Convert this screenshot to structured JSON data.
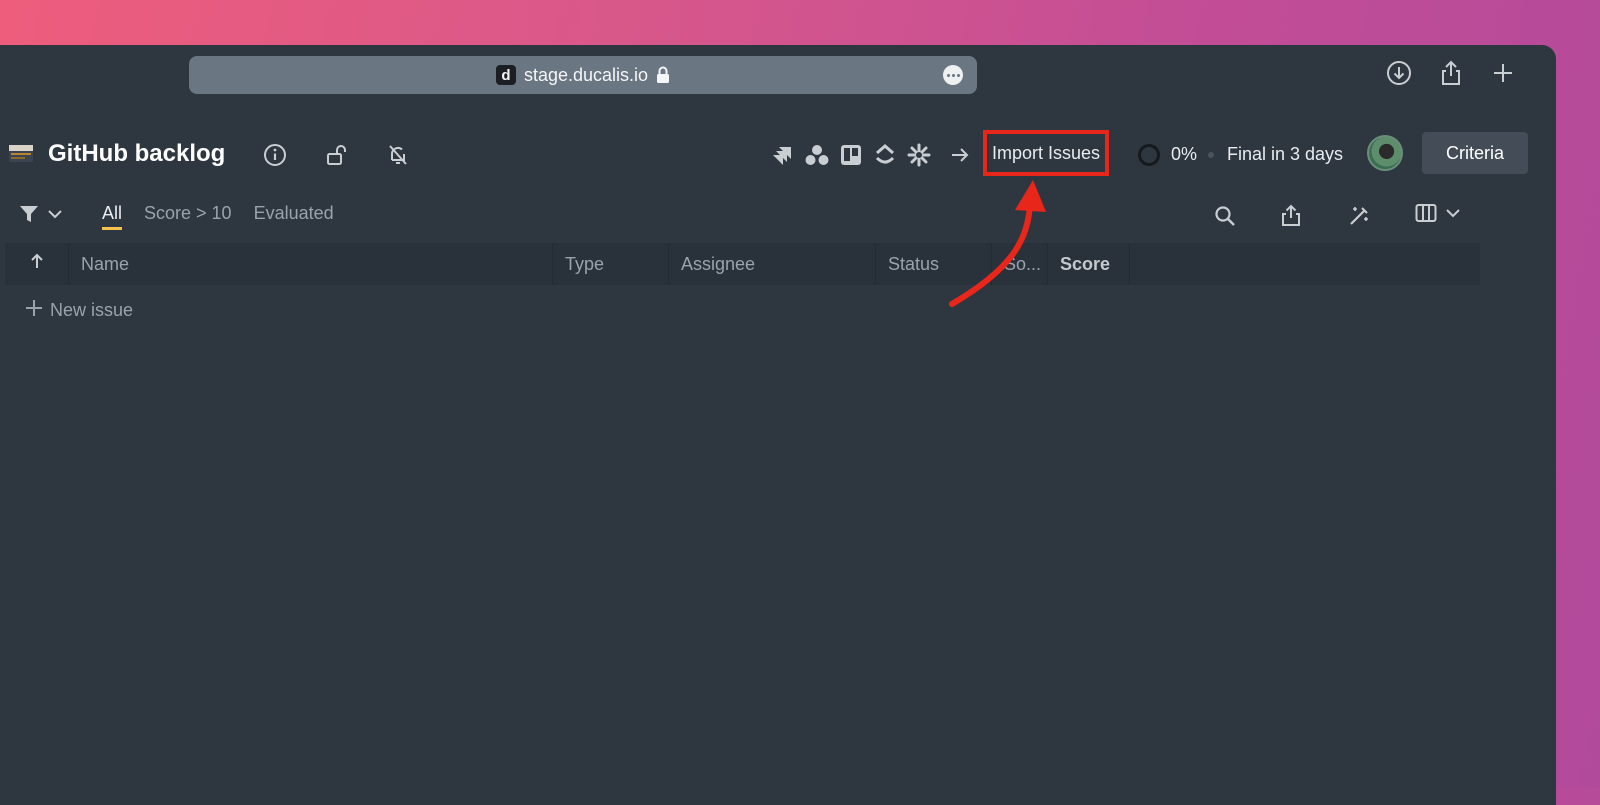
{
  "browser": {
    "favicon_letter": "d",
    "url": "stage.ducalis.io",
    "icons": [
      "lock-icon",
      "more-icon",
      "download-icon",
      "share-icon",
      "new-tab-icon"
    ]
  },
  "header": {
    "title": "GitHub backlog",
    "icons": [
      "info-icon",
      "unlock-icon",
      "notifications-off-icon"
    ],
    "integrations": [
      "jira-icon",
      "asana-icon",
      "trello-icon",
      "clickup-icon",
      "zapier-icon"
    ],
    "import_label": "Import Issues",
    "progress_percent": "0%",
    "deadline": "Final in 3 days",
    "criteria_label": "Criteria"
  },
  "filters": {
    "tabs": [
      {
        "label": "All",
        "active": true
      },
      {
        "label": "Score > 10",
        "active": false
      },
      {
        "label": "Evaluated",
        "active": false
      }
    ],
    "tools": [
      "search-icon",
      "export-icon",
      "wand-icon",
      "columns-icon"
    ]
  },
  "table": {
    "columns": [
      "Name",
      "Type",
      "Assignee",
      "Status",
      "So...",
      "Score"
    ],
    "new_issue_label": "New issue"
  },
  "colors": {
    "background": "#2e3640",
    "highlight": "#e8261a",
    "active_tab_underline": "#f2c24a"
  }
}
